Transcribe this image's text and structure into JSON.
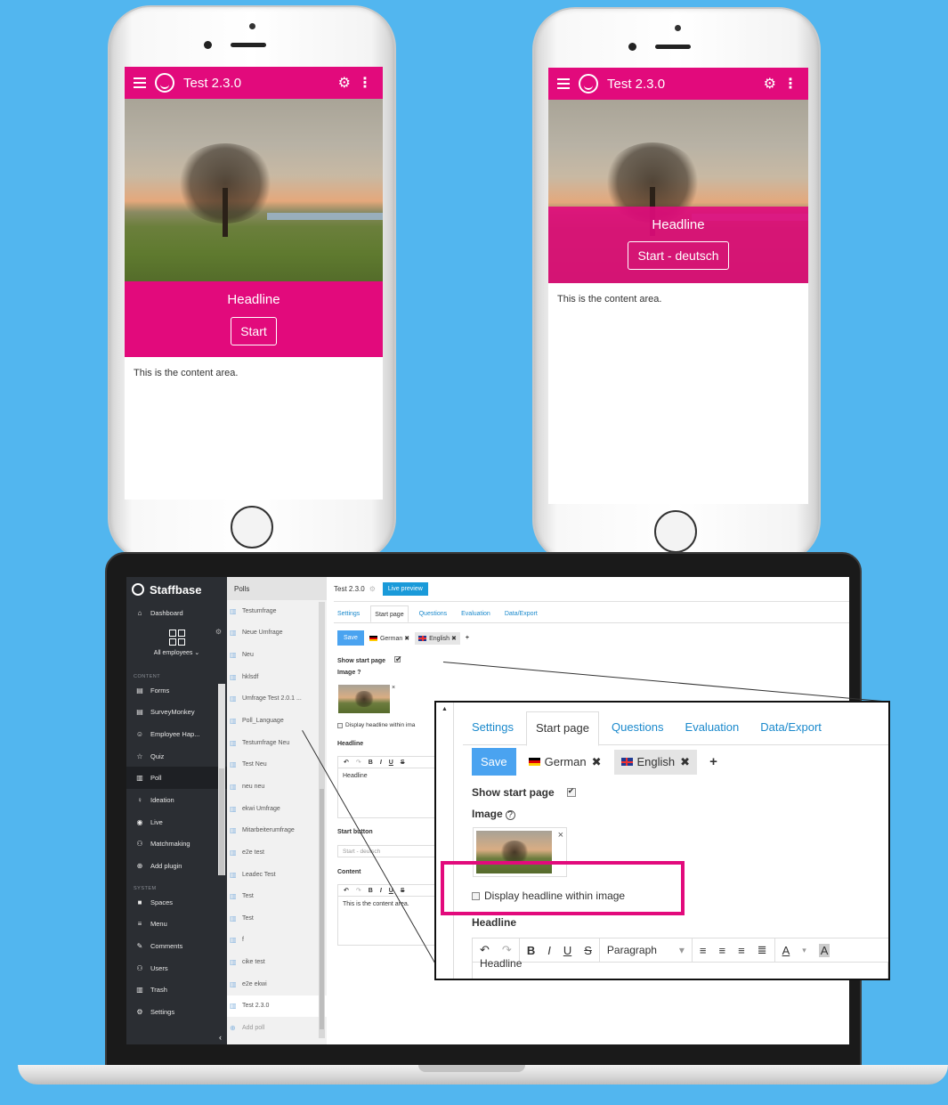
{
  "phone_left": {
    "app_title": "Test 2.3.0",
    "headline": "Headline",
    "start_button": "Start",
    "content_text": "This is the content area."
  },
  "phone_right": {
    "app_title": "Test 2.3.0",
    "headline": "Headline",
    "start_button": "Start - deutsch",
    "content_text": "This is the content area."
  },
  "colors": {
    "brand_pink": "#e20a7c",
    "background": "#52b6ef",
    "link_blue": "#1a89cc",
    "save_blue": "#4aa3f0"
  },
  "laptop": {
    "sidebar": {
      "brand": "Staffbase",
      "dashboard": "Dashboard",
      "audience": "All employees",
      "content_section": "CONTENT",
      "content_items": [
        {
          "label": "Forms",
          "icon": "forms-icon"
        },
        {
          "label": "SurveyMonkey",
          "icon": "survey-icon"
        },
        {
          "label": "Employee Hap...",
          "icon": "smile-icon"
        },
        {
          "label": "Quiz",
          "icon": "star-icon"
        },
        {
          "label": "Poll",
          "icon": "bar-chart-icon"
        },
        {
          "label": "Ideation",
          "icon": "lightbulb-icon"
        },
        {
          "label": "Live",
          "icon": "live-icon"
        },
        {
          "label": "Matchmaking",
          "icon": "people-icon"
        },
        {
          "label": "Add plugin",
          "icon": "plus-circle-icon"
        }
      ],
      "system_section": "SYSTEM",
      "system_items": [
        {
          "label": "Spaces",
          "icon": "spaces-icon"
        },
        {
          "label": "Menu",
          "icon": "menu-icon"
        },
        {
          "label": "Comments",
          "icon": "comments-icon"
        },
        {
          "label": "Users",
          "icon": "users-icon"
        },
        {
          "label": "Trash",
          "icon": "trash-icon"
        },
        {
          "label": "Settings",
          "icon": "gear-icon"
        }
      ]
    },
    "polls": {
      "header": "Polls",
      "items": [
        "Testumfrage",
        "Neue Umfrage",
        "Neu",
        "hklsdf",
        "Umfrage Test 2.0.1 ...",
        "Poll_Language",
        "Testumfrage Neu",
        "Test Neu",
        "neu neu",
        "ekwi Umfrage",
        "Mitarbeiterumfrage",
        "e2e test",
        "Leadec Test",
        "Test",
        "Test",
        "f",
        "cike test",
        "e2e ekwi",
        "Test 2.3.0"
      ],
      "add": "Add poll"
    },
    "editor": {
      "title": "Test 2.3.0",
      "live_preview": "Live preview",
      "tabs": [
        "Settings",
        "Start page",
        "Questions",
        "Evaluation",
        "Data/Export"
      ],
      "save": "Save",
      "lang_german": "German",
      "lang_english": "English",
      "show_start_page": "Show start page",
      "image_label": "Image",
      "display_headline": "Display headline within ima",
      "headline_label": "Headline",
      "headline_value": "Headline",
      "start_button_label": "Start button",
      "start_button_value": "Start - deutsch",
      "content_label": "Content",
      "content_value": "This is the content area."
    }
  },
  "zoom": {
    "tabs": [
      "Settings",
      "Start page",
      "Questions",
      "Evaluation",
      "Data/Export"
    ],
    "save": "Save",
    "lang_german": "German",
    "lang_english": "English",
    "add_lang": "+",
    "show_start_page": "Show start page",
    "image_label": "Image",
    "help": "?",
    "display_headline": "Display headline within image",
    "headline_label": "Headline",
    "paragraph": "Paragraph",
    "cut_off_text": "Headline"
  }
}
